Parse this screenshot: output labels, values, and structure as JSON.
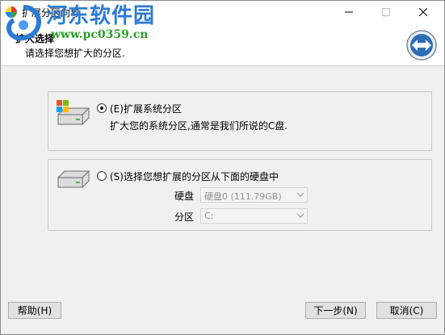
{
  "window": {
    "title": "扩展分区向导"
  },
  "watermark": {
    "site_name": "河东软件园",
    "url": "www.pc0359.cn"
  },
  "header": {
    "title": "扩大选择",
    "subtitle": "请选择您想扩大的分区."
  },
  "option_system": {
    "label": "(E)扩展系统分区",
    "description": "扩大您的系统分区,通常是我们所说的C盘.",
    "selected": true
  },
  "option_select": {
    "label": "(S)选择您想扩展的分区从下面的硬盘中",
    "selected": false,
    "disk_label": "硬盘",
    "disk_value": "硬盘0 (111.79GB)",
    "partition_label": "分区",
    "partition_value": "C:"
  },
  "buttons": {
    "help": "帮助(H)",
    "next": "下一步(N)",
    "cancel": "取消(C)"
  },
  "colors": {
    "main_bg": "#f0f0f0",
    "watermark_blue": "#2c7bd4",
    "watermark_green": "#2aa02a"
  }
}
